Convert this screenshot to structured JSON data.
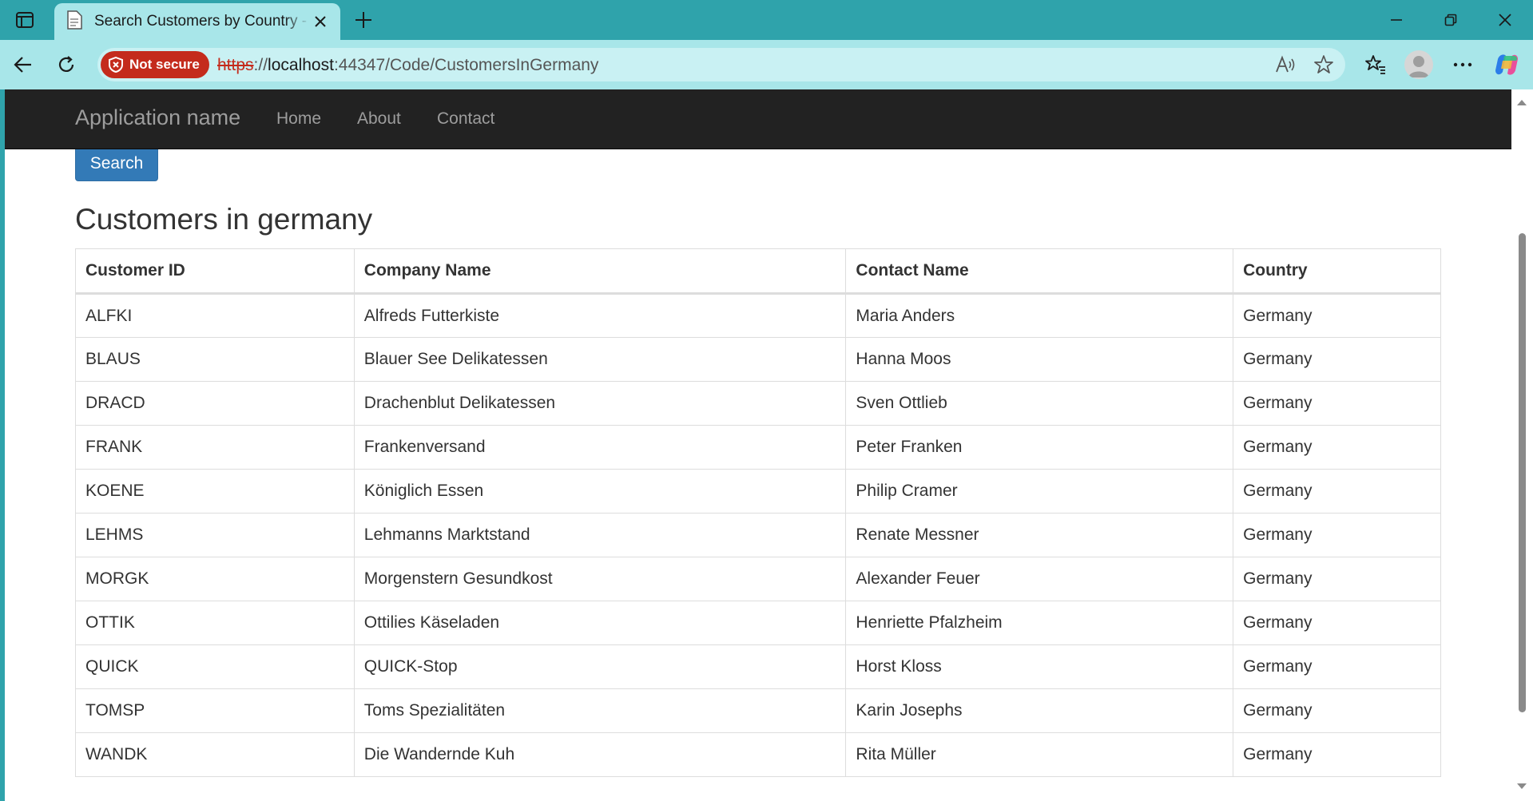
{
  "browser": {
    "tab_title": "Search Customers by Country - M",
    "security_label": "Not secure",
    "url_scheme": "https",
    "url_sep": "://",
    "url_host": "localhost",
    "url_path": ":44347/Code/CustomersInGermany"
  },
  "app": {
    "brand": "Application name",
    "nav": [
      {
        "label": "Home"
      },
      {
        "label": "About"
      },
      {
        "label": "Contact"
      }
    ],
    "search_label": "Search",
    "page_title": "Customers in germany"
  },
  "table": {
    "headers": [
      "Customer ID",
      "Company Name",
      "Contact Name",
      "Country"
    ],
    "rows": [
      [
        "ALFKI",
        "Alfreds Futterkiste",
        "Maria Anders",
        "Germany"
      ],
      [
        "BLAUS",
        "Blauer See Delikatessen",
        "Hanna Moos",
        "Germany"
      ],
      [
        "DRACD",
        "Drachenblut Delikatessen",
        "Sven Ottlieb",
        "Germany"
      ],
      [
        "FRANK",
        "Frankenversand",
        "Peter Franken",
        "Germany"
      ],
      [
        "KOENE",
        "Königlich Essen",
        "Philip Cramer",
        "Germany"
      ],
      [
        "LEHMS",
        "Lehmanns Marktstand",
        "Renate Messner",
        "Germany"
      ],
      [
        "MORGK",
        "Morgenstern Gesundkost",
        "Alexander Feuer",
        "Germany"
      ],
      [
        "OTTIK",
        "Ottilies Käseladen",
        "Henriette Pfalzheim",
        "Germany"
      ],
      [
        "QUICK",
        "QUICK-Stop",
        "Horst Kloss",
        "Germany"
      ],
      [
        "TOMSP",
        "Toms Spezialitäten",
        "Karin Josephs",
        "Germany"
      ],
      [
        "WANDK",
        "Die Wandernde Kuh",
        "Rita Müller",
        "Germany"
      ]
    ]
  },
  "colors": {
    "browser_frame": "#2fa3ab",
    "toolbar": "#a8e6e9",
    "navbar": "#222222",
    "primary_button": "#337ab7",
    "not_secure": "#c42b1c"
  }
}
